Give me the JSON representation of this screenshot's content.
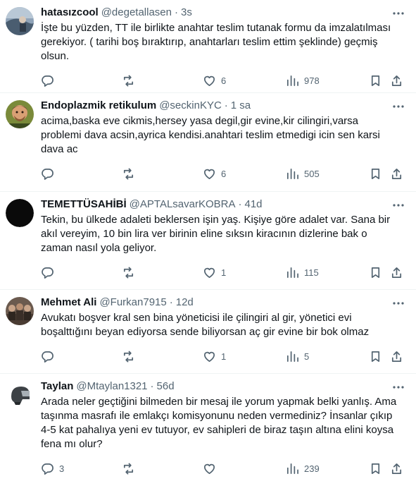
{
  "tweets": [
    {
      "name": "hatasızcool",
      "handle": "@degetallasen",
      "time": "3s",
      "text": "İşte bu yüzden, TT ile birlikte anahtar teslim tutanak formu da imzalatılması gerekiyor. ( tarihi boş bıraktırıp, anahtarları teslim ettim şeklinde) geçmiş olsun.",
      "replies": "",
      "retweets": "",
      "likes": "6",
      "views": "978"
    },
    {
      "name": "Endoplazmik retikulum",
      "handle": "@seckinKYC",
      "time": "1 sa",
      "text": "acima,baska eve cikmis,hersey yasa degil,gir evine,kir cilingiri,varsa problemi dava acsin,ayrica kendisi.anahtari teslim etmedigi icin sen karsi dava ac",
      "replies": "",
      "retweets": "",
      "likes": "6",
      "views": "505"
    },
    {
      "name": "TEMETTÜSAHİBİ",
      "handle": "@APTALsavarKOBRA",
      "time": "41d",
      "text": "Tekin, bu ülkede adaleti beklersen işin yaş. Kişiye göre adalet var. Sana bir akıl vereyim, 10 bin lira ver birinin eline sıksın kiracının dizlerine bak o zaman nasıl yola geliyor.",
      "replies": "",
      "retweets": "",
      "likes": "1",
      "views": "115"
    },
    {
      "name": "Mehmet Ali",
      "handle": "@Furkan7915",
      "time": "12d",
      "text": "Avukatı boşver kral sen bina yöneticisi ile çilingiri al gir, yönetici evi boşalttığını beyan ediyorsa sende biliyorsan aç gir evine bir bok olmaz",
      "replies": "",
      "retweets": "",
      "likes": "1",
      "views": "5"
    },
    {
      "name": "Taylan",
      "handle": "@Mtaylan1321",
      "time": "56d",
      "text": "Arada neler geçtiğini bilmeden bir mesaj ile yorum yapmak belki yanlış. Ama taşınma masrafı ile emlakçı komisyonunu neden vermediniz? İnsanlar çıkıp 4-5 kat pahalıya yeni ev tutuyor, ev sahipleri de biraz taşın altına elini koysa fena mı olur?",
      "replies": "3",
      "retweets": "",
      "likes": "",
      "views": "239"
    }
  ],
  "icons": {
    "reply": "reply-icon",
    "retweet": "retweet-icon",
    "like": "heart-icon",
    "views": "views-chart-icon",
    "bookmark": "bookmark-icon",
    "share": "share-icon",
    "more": "more-dots-icon"
  },
  "colors": {
    "text": "#0f1419",
    "secondary": "#536471",
    "divider": "#eff3f4"
  }
}
